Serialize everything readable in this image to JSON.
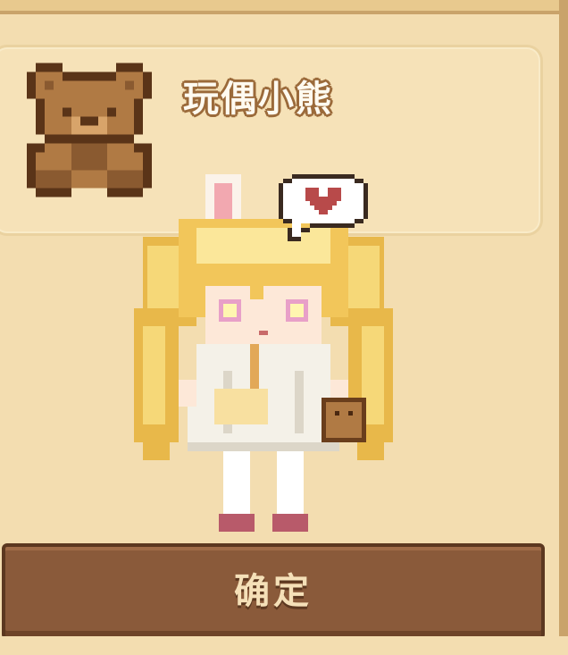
{
  "item": {
    "name": "玩偶小熊",
    "icon": "teddy-bear-icon"
  },
  "character": {
    "emote": "heart-speech-bubble-icon"
  },
  "confirm": {
    "label": "确定"
  },
  "colors": {
    "background": "#f3ddb0",
    "card": "#f6e2b8",
    "title_outline": "#9b6a3a",
    "button": "#8a5a3a",
    "button_border": "#5c3820",
    "button_text": "#f5e0b8",
    "bear": "#b07a44",
    "bear_dark": "#5a3418",
    "heart": "#b84a4a"
  }
}
